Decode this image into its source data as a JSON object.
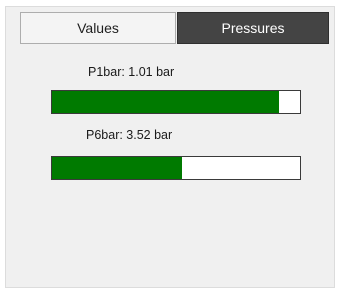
{
  "tabs": [
    {
      "label": "Values",
      "selected": false
    },
    {
      "label": "Pressures",
      "selected": true
    }
  ],
  "gauges": [
    {
      "label": "P1bar: 1.01 bar",
      "fill_fraction": 0.915
    },
    {
      "label": "P6bar: 3.52 bar",
      "fill_fraction": 0.525
    }
  ],
  "colors": {
    "bar_fill": "#007a00",
    "selected_tab_bg": "#444444",
    "panel_bg": "#f0f0f0"
  }
}
